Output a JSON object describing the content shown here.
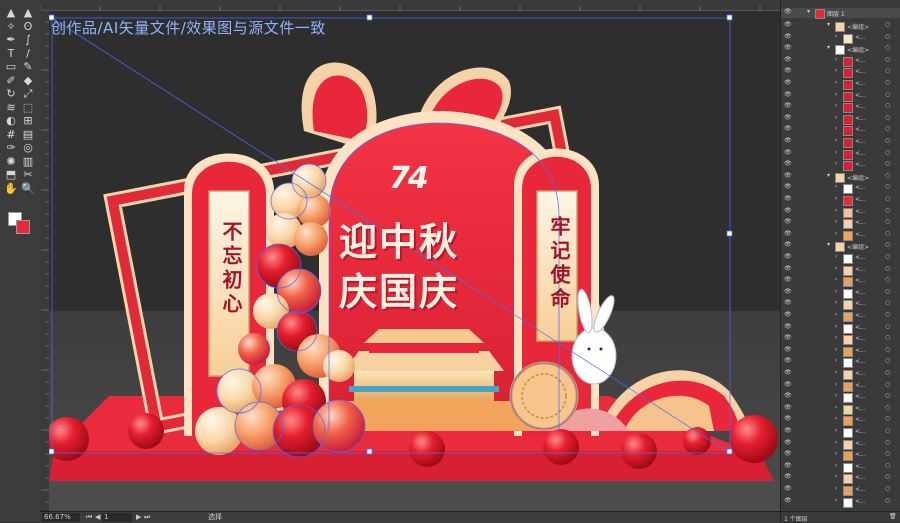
{
  "document": {
    "watermark": "创作品/AI矢量文件/效果图与源文件一致",
    "zoom": "66.67%",
    "artboard_number": "1",
    "status_text": "选择"
  },
  "artwork": {
    "number_mark": "74",
    "headline_line1": "迎中秋",
    "headline_line2": "庆国庆",
    "left_banner": "不忘初心",
    "right_banner": "牢记使命"
  },
  "layers_panel": {
    "top_layer": "图层 1",
    "group_label": "<编组>",
    "item_label": "<...",
    "footer_count": "1 个图层"
  },
  "tools": [
    {
      "icon": "selection-tool-icon",
      "glyph": "▲"
    },
    {
      "icon": "direct-selection-tool-icon",
      "glyph": "▲"
    },
    {
      "icon": "magic-wand-tool-icon",
      "glyph": "✧"
    },
    {
      "icon": "lasso-tool-icon",
      "glyph": "ʘ"
    },
    {
      "icon": "pen-tool-icon",
      "glyph": "✒"
    },
    {
      "icon": "curvature-tool-icon",
      "glyph": "∫"
    },
    {
      "icon": "type-tool-icon",
      "glyph": "T"
    },
    {
      "icon": "line-tool-icon",
      "glyph": "/"
    },
    {
      "icon": "rectangle-tool-icon",
      "glyph": "▭"
    },
    {
      "icon": "paintbrush-tool-icon",
      "glyph": "✎"
    },
    {
      "icon": "shaper-tool-icon",
      "glyph": "✐"
    },
    {
      "icon": "eraser-tool-icon",
      "glyph": "◆"
    },
    {
      "icon": "rotate-tool-icon",
      "glyph": "↻"
    },
    {
      "icon": "scale-tool-icon",
      "glyph": "⤢"
    },
    {
      "icon": "width-tool-icon",
      "glyph": "≋"
    },
    {
      "icon": "free-transform-tool-icon",
      "glyph": "⬚"
    },
    {
      "icon": "shape-builder-tool-icon",
      "glyph": "◐"
    },
    {
      "icon": "perspective-grid-tool-icon",
      "glyph": "⊞"
    },
    {
      "icon": "mesh-tool-icon",
      "glyph": "#"
    },
    {
      "icon": "gradient-tool-icon",
      "glyph": "▤"
    },
    {
      "icon": "eyedropper-tool-icon",
      "glyph": "✑"
    },
    {
      "icon": "blend-tool-icon",
      "glyph": "◎"
    },
    {
      "icon": "symbol-sprayer-tool-icon",
      "glyph": "✺"
    },
    {
      "icon": "column-graph-tool-icon",
      "glyph": "▥"
    },
    {
      "icon": "artboard-tool-icon",
      "glyph": "⬒"
    },
    {
      "icon": "slice-tool-icon",
      "glyph": "✂"
    },
    {
      "icon": "hand-tool-icon",
      "glyph": "✋"
    },
    {
      "icon": "zoom-tool-icon",
      "glyph": "🔍"
    }
  ],
  "colors": {
    "ui_dark": "#323232",
    "red_main": "#e8283a",
    "red_deep": "#b8162a",
    "cream": "#fbe3c4",
    "gold": "#e7b46c",
    "selection_blue": "#4a6cff"
  }
}
